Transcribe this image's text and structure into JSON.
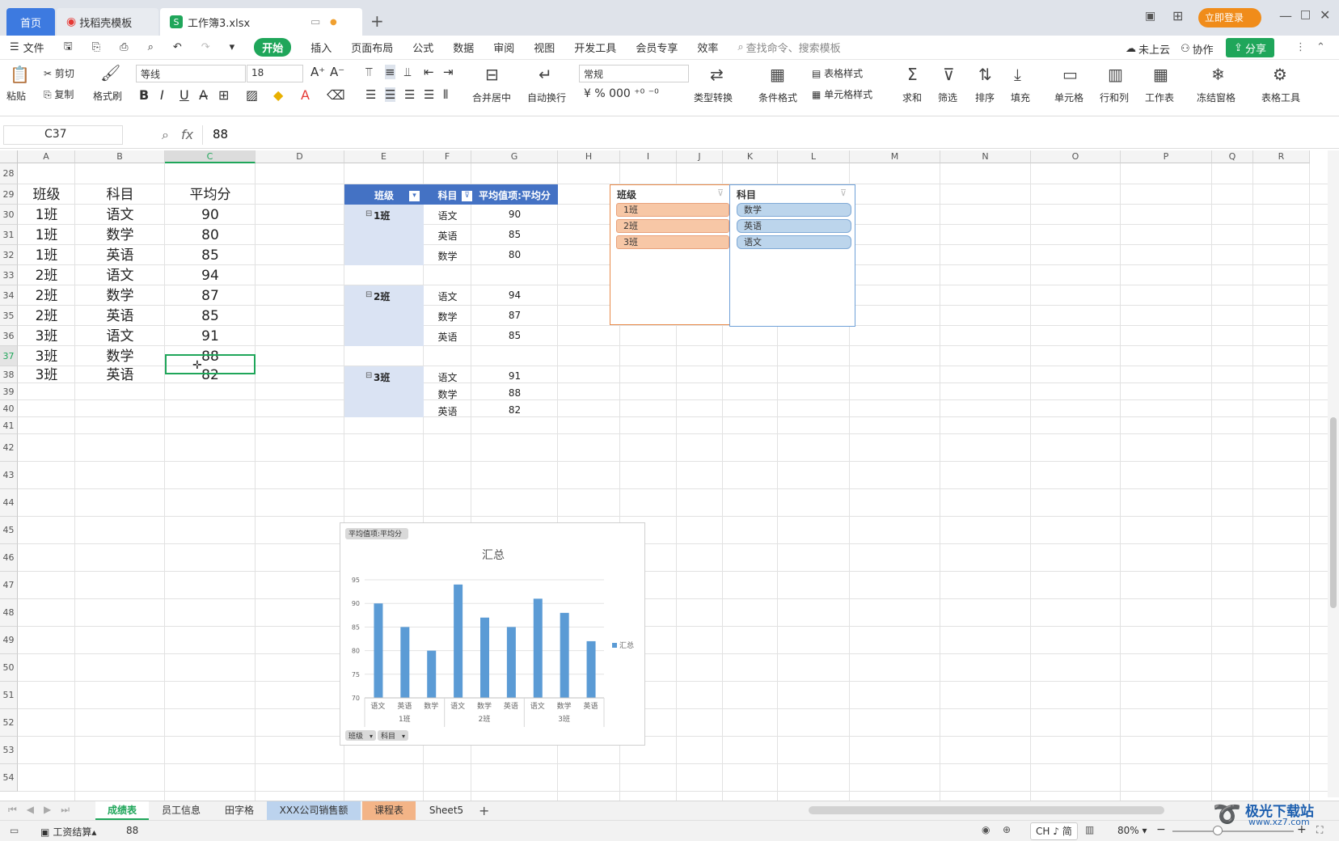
{
  "tabs": {
    "home": "首页",
    "template": "找稻壳模板",
    "file": "工作簿3.xlsx",
    "login": "立即登录"
  },
  "menu": {
    "file": "文件",
    "items": [
      "开始",
      "插入",
      "页面布局",
      "公式",
      "数据",
      "审阅",
      "视图",
      "开发工具",
      "会员专享",
      "效率"
    ],
    "search": "查找命令、搜索模板",
    "cloud": "未上云",
    "collab": "协作",
    "share": "分享"
  },
  "ribbon": {
    "paste": "粘贴",
    "cut": "剪切",
    "copy": "复制",
    "painter": "格式刷",
    "font": "等线",
    "size": "18",
    "numfmt": "常规",
    "merge": "合并居中",
    "wrap": "自动换行",
    "convert": "类型转换",
    "cond": "条件格式",
    "tstyle": "表格样式",
    "cstyle": "单元格样式",
    "sum": "求和",
    "filter": "筛选",
    "sort": "排序",
    "fill": "填充",
    "cell": "单元格",
    "rowcol": "行和列",
    "sheet": "工作表",
    "freeze": "冻结窗格",
    "tools": "表格工具"
  },
  "formula": {
    "namebox": "C37",
    "fx": "fx",
    "value": "88"
  },
  "columns": [
    "A",
    "B",
    "C",
    "D",
    "E",
    "F",
    "G",
    "H",
    "I",
    "J",
    "K",
    "L",
    "M",
    "N",
    "O",
    "P",
    "Q",
    "R"
  ],
  "rows": [
    "28",
    "29",
    "30",
    "31",
    "32",
    "33",
    "34",
    "35",
    "36",
    "37",
    "38",
    "39",
    "40",
    "41",
    "42",
    "43",
    "44",
    "45",
    "46",
    "47",
    "48",
    "49",
    "50",
    "51",
    "52",
    "53",
    "54"
  ],
  "table": {
    "headers": [
      "班级",
      "科目",
      "平均分"
    ],
    "rows": [
      [
        "1班",
        "语文",
        "90"
      ],
      [
        "1班",
        "数学",
        "80"
      ],
      [
        "1班",
        "英语",
        "85"
      ],
      [
        "2班",
        "语文",
        "94"
      ],
      [
        "2班",
        "数学",
        "87"
      ],
      [
        "2班",
        "英语",
        "85"
      ],
      [
        "3班",
        "语文",
        "91"
      ],
      [
        "3班",
        "数学",
        "88"
      ],
      [
        "3班",
        "英语",
        "82"
      ]
    ]
  },
  "pivot": {
    "headers": [
      "班级",
      "科目",
      "平均值项:平均分"
    ],
    "groups": [
      {
        "name": "1班",
        "items": [
          [
            "语文",
            "90"
          ],
          [
            "英语",
            "85"
          ],
          [
            "数学",
            "80"
          ]
        ]
      },
      {
        "name": "2班",
        "items": [
          [
            "语文",
            "94"
          ],
          [
            "数学",
            "87"
          ],
          [
            "英语",
            "85"
          ]
        ]
      },
      {
        "name": "3班",
        "items": [
          [
            "语文",
            "91"
          ],
          [
            "数学",
            "88"
          ],
          [
            "英语",
            "82"
          ]
        ]
      }
    ]
  },
  "slicers": {
    "class": {
      "title": "班级",
      "items": [
        "1班",
        "2班",
        "3班"
      ]
    },
    "subject": {
      "title": "科目",
      "items": [
        "数学",
        "英语",
        "语文"
      ]
    }
  },
  "chart_data": {
    "type": "bar",
    "title": "汇总",
    "field_button": "平均值项:平均分",
    "legend": "汇总",
    "axis_buttons": [
      "班级",
      "科目"
    ],
    "categories": [
      "语文",
      "英语",
      "数学",
      "语文",
      "数学",
      "英语",
      "语文",
      "数学",
      "英语"
    ],
    "groups": [
      "1班",
      "2班",
      "3班"
    ],
    "series": [
      {
        "name": "汇总",
        "values": [
          90,
          85,
          80,
          94,
          87,
          85,
          91,
          88,
          82
        ]
      }
    ],
    "ylim": [
      70,
      95
    ],
    "yticks": [
      70,
      75,
      80,
      85,
      90,
      95
    ],
    "color": "#5b9bd5"
  },
  "sheets": [
    "成绩表",
    "员工信息",
    "田字格",
    "XXX公司销售额",
    "课程表",
    "Sheet5"
  ],
  "status": {
    "workbook": "工资结算",
    "value": "88",
    "ime": "CH ♪ 简",
    "zoom": "80%"
  },
  "watermark": {
    "name": "极光下载站",
    "url": "www.xz7.com"
  }
}
